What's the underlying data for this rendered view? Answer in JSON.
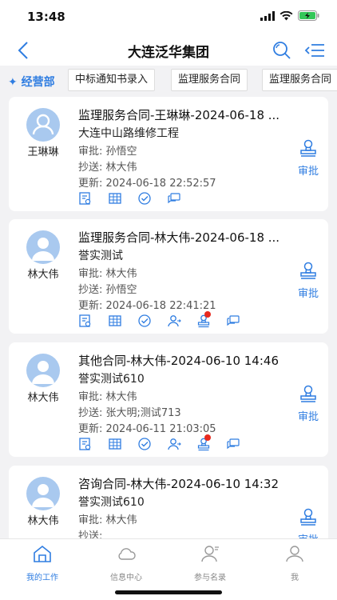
{
  "status_bar": {
    "time": "13:48"
  },
  "nav": {
    "title": "大连泛华集团"
  },
  "tabs": {
    "department": "✦ 经营部",
    "items": [
      "中标通知书录入",
      "监理服务合同",
      "监理服务合同"
    ]
  },
  "cards": [
    {
      "name": "王琳琳",
      "title": "监理服务合同-王琳琳-2024-06-18 ...",
      "subtitle": "大连中山路维修工程",
      "approval": "审批: 孙悟空",
      "cc": "抄送: 林大伟",
      "updated": "更新: 2024-06-18 22:52:57",
      "approve_label": "审批",
      "actions": [
        "document-search-icon",
        "table-icon",
        "check-circle-icon",
        "chat-icon"
      ]
    },
    {
      "name": "林大伟",
      "title": "监理服务合同-林大伟-2024-06-18 ...",
      "subtitle": "誉实测试",
      "approval": "审批: 林大伟",
      "cc": "抄送: 孙悟空",
      "updated": "更新: 2024-06-18 22:41:21",
      "approve_label": "审批",
      "actions": [
        "document-search-icon",
        "table-icon",
        "check-circle-icon",
        "user-transfer-icon",
        "stamp-icon",
        "chat-icon"
      ]
    },
    {
      "name": "林大伟",
      "title": "其他合同-林大伟-2024-06-10 14:46",
      "subtitle": "誉实测试610",
      "approval": "审批: 林大伟",
      "cc": "抄送: 张大明;测试713",
      "updated": "更新: 2024-06-11 21:03:05",
      "approve_label": "审批",
      "actions": [
        "document-search-icon",
        "table-icon",
        "check-circle-icon",
        "user-transfer-icon",
        "stamp-icon",
        "chat-icon"
      ]
    },
    {
      "name": "林大伟",
      "title": "咨询合同-林大伟-2024-06-10 14:32",
      "subtitle": "誉实测试610",
      "approval": "审批: 林大伟",
      "cc": "抄送:",
      "updated": "",
      "approve_label": "审批",
      "actions": []
    }
  ],
  "bottom_tabs": [
    {
      "label": "我的工作",
      "icon": "home-icon",
      "active": true
    },
    {
      "label": "信息中心",
      "icon": "cloud-icon",
      "active": false
    },
    {
      "label": "参与名录",
      "icon": "user-list-icon",
      "active": false
    },
    {
      "label": "我",
      "icon": "profile-icon",
      "active": false
    }
  ],
  "colors": {
    "accent": "#2f7de1",
    "badge": "#e82a1f",
    "avatar": "#a9c9ef"
  }
}
